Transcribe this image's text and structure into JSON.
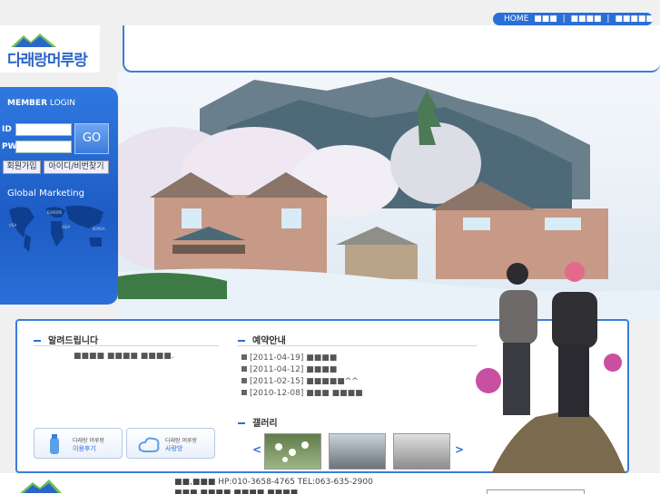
{
  "nav": {
    "home": "HOME",
    "items": [
      "■■■",
      "■■■■",
      "■■■■■■"
    ],
    "sep": "|"
  },
  "logo": {
    "text": "다래랑머루랑"
  },
  "login": {
    "title_a": "MEMBER",
    "title_b": "LOGIN",
    "id_label": "ID",
    "pw_label": "PW",
    "go": "GO",
    "join": "회원가입",
    "find": "아이디/비번찾기",
    "global": "Global Marketing",
    "map_labels": [
      "USA",
      "EUROPE",
      "ASIA",
      "KOREA"
    ]
  },
  "notice": {
    "title": "알려드립니다",
    "text": "■■■■ ■■■■ ■■■■."
  },
  "reserve": {
    "title": "예약안내",
    "items": [
      {
        "date": "[2011-04-19]",
        "text": "■■■■"
      },
      {
        "date": "[2011-04-12]",
        "text": "■■■■"
      },
      {
        "date": "[2011-02-15]",
        "text": "■■■■■^^"
      },
      {
        "date": "[2010-12-08]",
        "text": "■■■ ■■■■"
      }
    ]
  },
  "gallery": {
    "title": "갤러리",
    "prev": "<",
    "next": ">"
  },
  "banners": [
    {
      "small": "다래랑 머루랑",
      "big": "이용후기"
    },
    {
      "small": "다래랑 머루랑",
      "big": "사랑방"
    }
  ],
  "footer": {
    "line1": "■■,■■■ HP:010-3658-4765 TEL:063-635-2900",
    "line2": "■■■ ■■■■ ■■■■ ■■■■"
  },
  "colors": {
    "accent": "#2a6fd6",
    "border": "#3b7ddb"
  }
}
